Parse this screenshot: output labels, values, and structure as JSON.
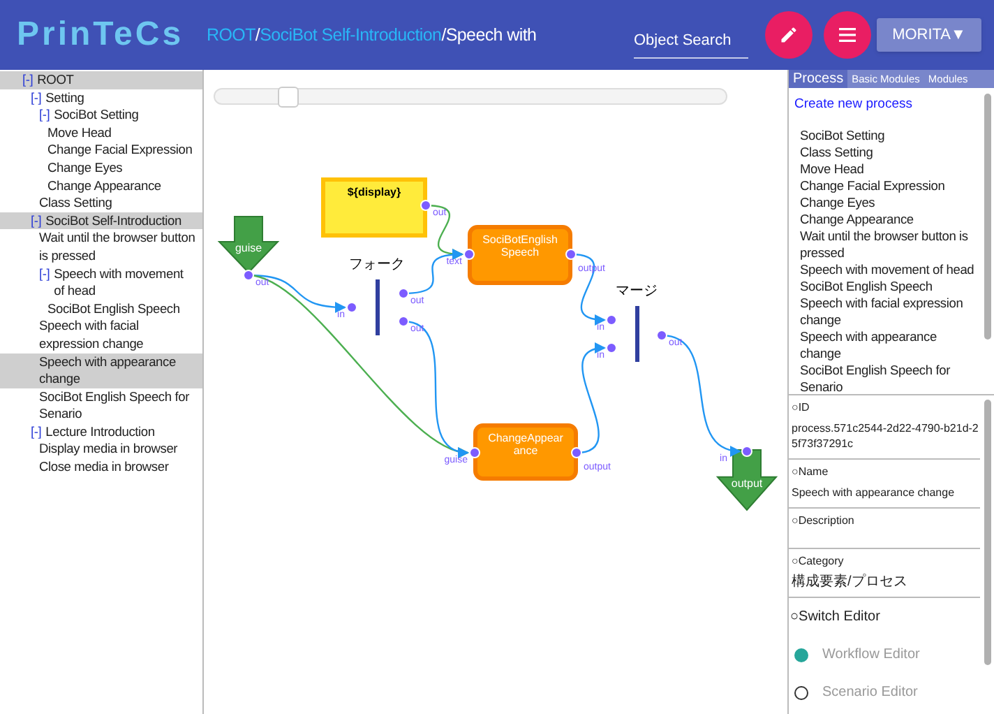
{
  "header": {
    "logo": "PrinTeCs",
    "breadcrumb": [
      {
        "text": "ROOT",
        "kind": "link"
      },
      {
        "text": "/",
        "kind": "separator"
      },
      {
        "text": "SociBot Self-Introduction",
        "kind": "link"
      },
      {
        "text": "/Speech with",
        "kind": "current"
      }
    ],
    "search": {
      "placeholder": "Object Search"
    },
    "user_button": "MORITA▼"
  },
  "tree": [
    {
      "label": "ROOT",
      "toggle": "[-]",
      "selected": true,
      "children": [
        {
          "label": "Setting",
          "toggle": "[-]",
          "selected": false,
          "children": [
            {
              "label": "SociBot Setting",
              "toggle": "[-]",
              "selected": false,
              "children": [
                {
                  "label": "Move Head",
                  "selected": false
                },
                {
                  "label": "Change Facial Expression",
                  "selected": false
                },
                {
                  "label": "Change Eyes",
                  "selected": false
                },
                {
                  "label": "Change Appearance",
                  "selected": false
                }
              ]
            },
            {
              "label": "Class Setting",
              "selected": false
            }
          ]
        },
        {
          "label": "SociBot Self-Introduction",
          "toggle": "[-]",
          "selected": true,
          "children": [
            {
              "label": "Wait until the browser button is pressed",
              "selected": false
            },
            {
              "label": "Speech with movement of head",
              "toggle": "[-]",
              "selected": false,
              "children": [
                {
                  "label": "SociBot English Speech",
                  "selected": false
                }
              ]
            },
            {
              "label": "Speech with facial expression change",
              "selected": false
            },
            {
              "label": "Speech with appearance change",
              "selected": true
            },
            {
              "label": "SociBot English Speech for Senario",
              "selected": false
            }
          ]
        },
        {
          "label": "Lecture Introduction",
          "toggle": "[-]",
          "selected": false,
          "children": [
            {
              "label": "Display media in browser",
              "selected": false
            },
            {
              "label": "Close media in browser",
              "selected": false
            }
          ]
        }
      ]
    }
  ],
  "canvas": {
    "zoom_slider": {
      "level": 0.14
    },
    "nodes": [
      {
        "kind": "display",
        "label": "${display}",
        "ports": [
          "out"
        ]
      },
      {
        "kind": "input",
        "label": "guise",
        "ports": [
          "out"
        ]
      },
      {
        "kind": "fork",
        "label": "フォーク",
        "ports": [
          "in",
          "out",
          "out"
        ]
      },
      {
        "kind": "process",
        "label": "SociBotEnglishSpeech",
        "ports": [
          "text",
          "output"
        ]
      },
      {
        "kind": "process",
        "label": "ChangeAppearance",
        "ports": [
          "guise",
          "output"
        ]
      },
      {
        "kind": "merge",
        "label": "マージ",
        "ports": [
          "in",
          "in",
          "out"
        ]
      },
      {
        "kind": "output",
        "label": "output",
        "ports": [
          "in"
        ]
      }
    ]
  },
  "right_panel": {
    "tabs": [
      {
        "label": "Process",
        "selected": true
      },
      {
        "label": "Basic Modules",
        "selected": false
      },
      {
        "label": "Modules",
        "selected": false
      }
    ],
    "create_link": "Create new process",
    "processes": [
      "SociBot Setting",
      "Class Setting",
      "Move Head",
      "Change Facial Expression",
      "Change Eyes",
      "Change Appearance",
      "Wait until the browser button is pressed",
      "Speech with movement of head",
      "SociBot English Speech",
      "Speech with facial expression change",
      "Speech with appearance change",
      "SociBot English Speech for Senario"
    ],
    "properties": [
      {
        "label": "○ID",
        "value": "process.571c2544-2d22-4790-b21d-25f73f37291c"
      },
      {
        "label": "○Name",
        "value": "Speech with appearance change"
      },
      {
        "label": "○Description"
      },
      {
        "label": "○Category",
        "value": "構成要素/プロセス"
      }
    ],
    "editor_switch": {
      "label": "○Switch Editor",
      "options": [
        {
          "label": "Workflow Editor",
          "selected": true
        },
        {
          "label": "Scenario Editor",
          "selected": false
        }
      ]
    }
  }
}
